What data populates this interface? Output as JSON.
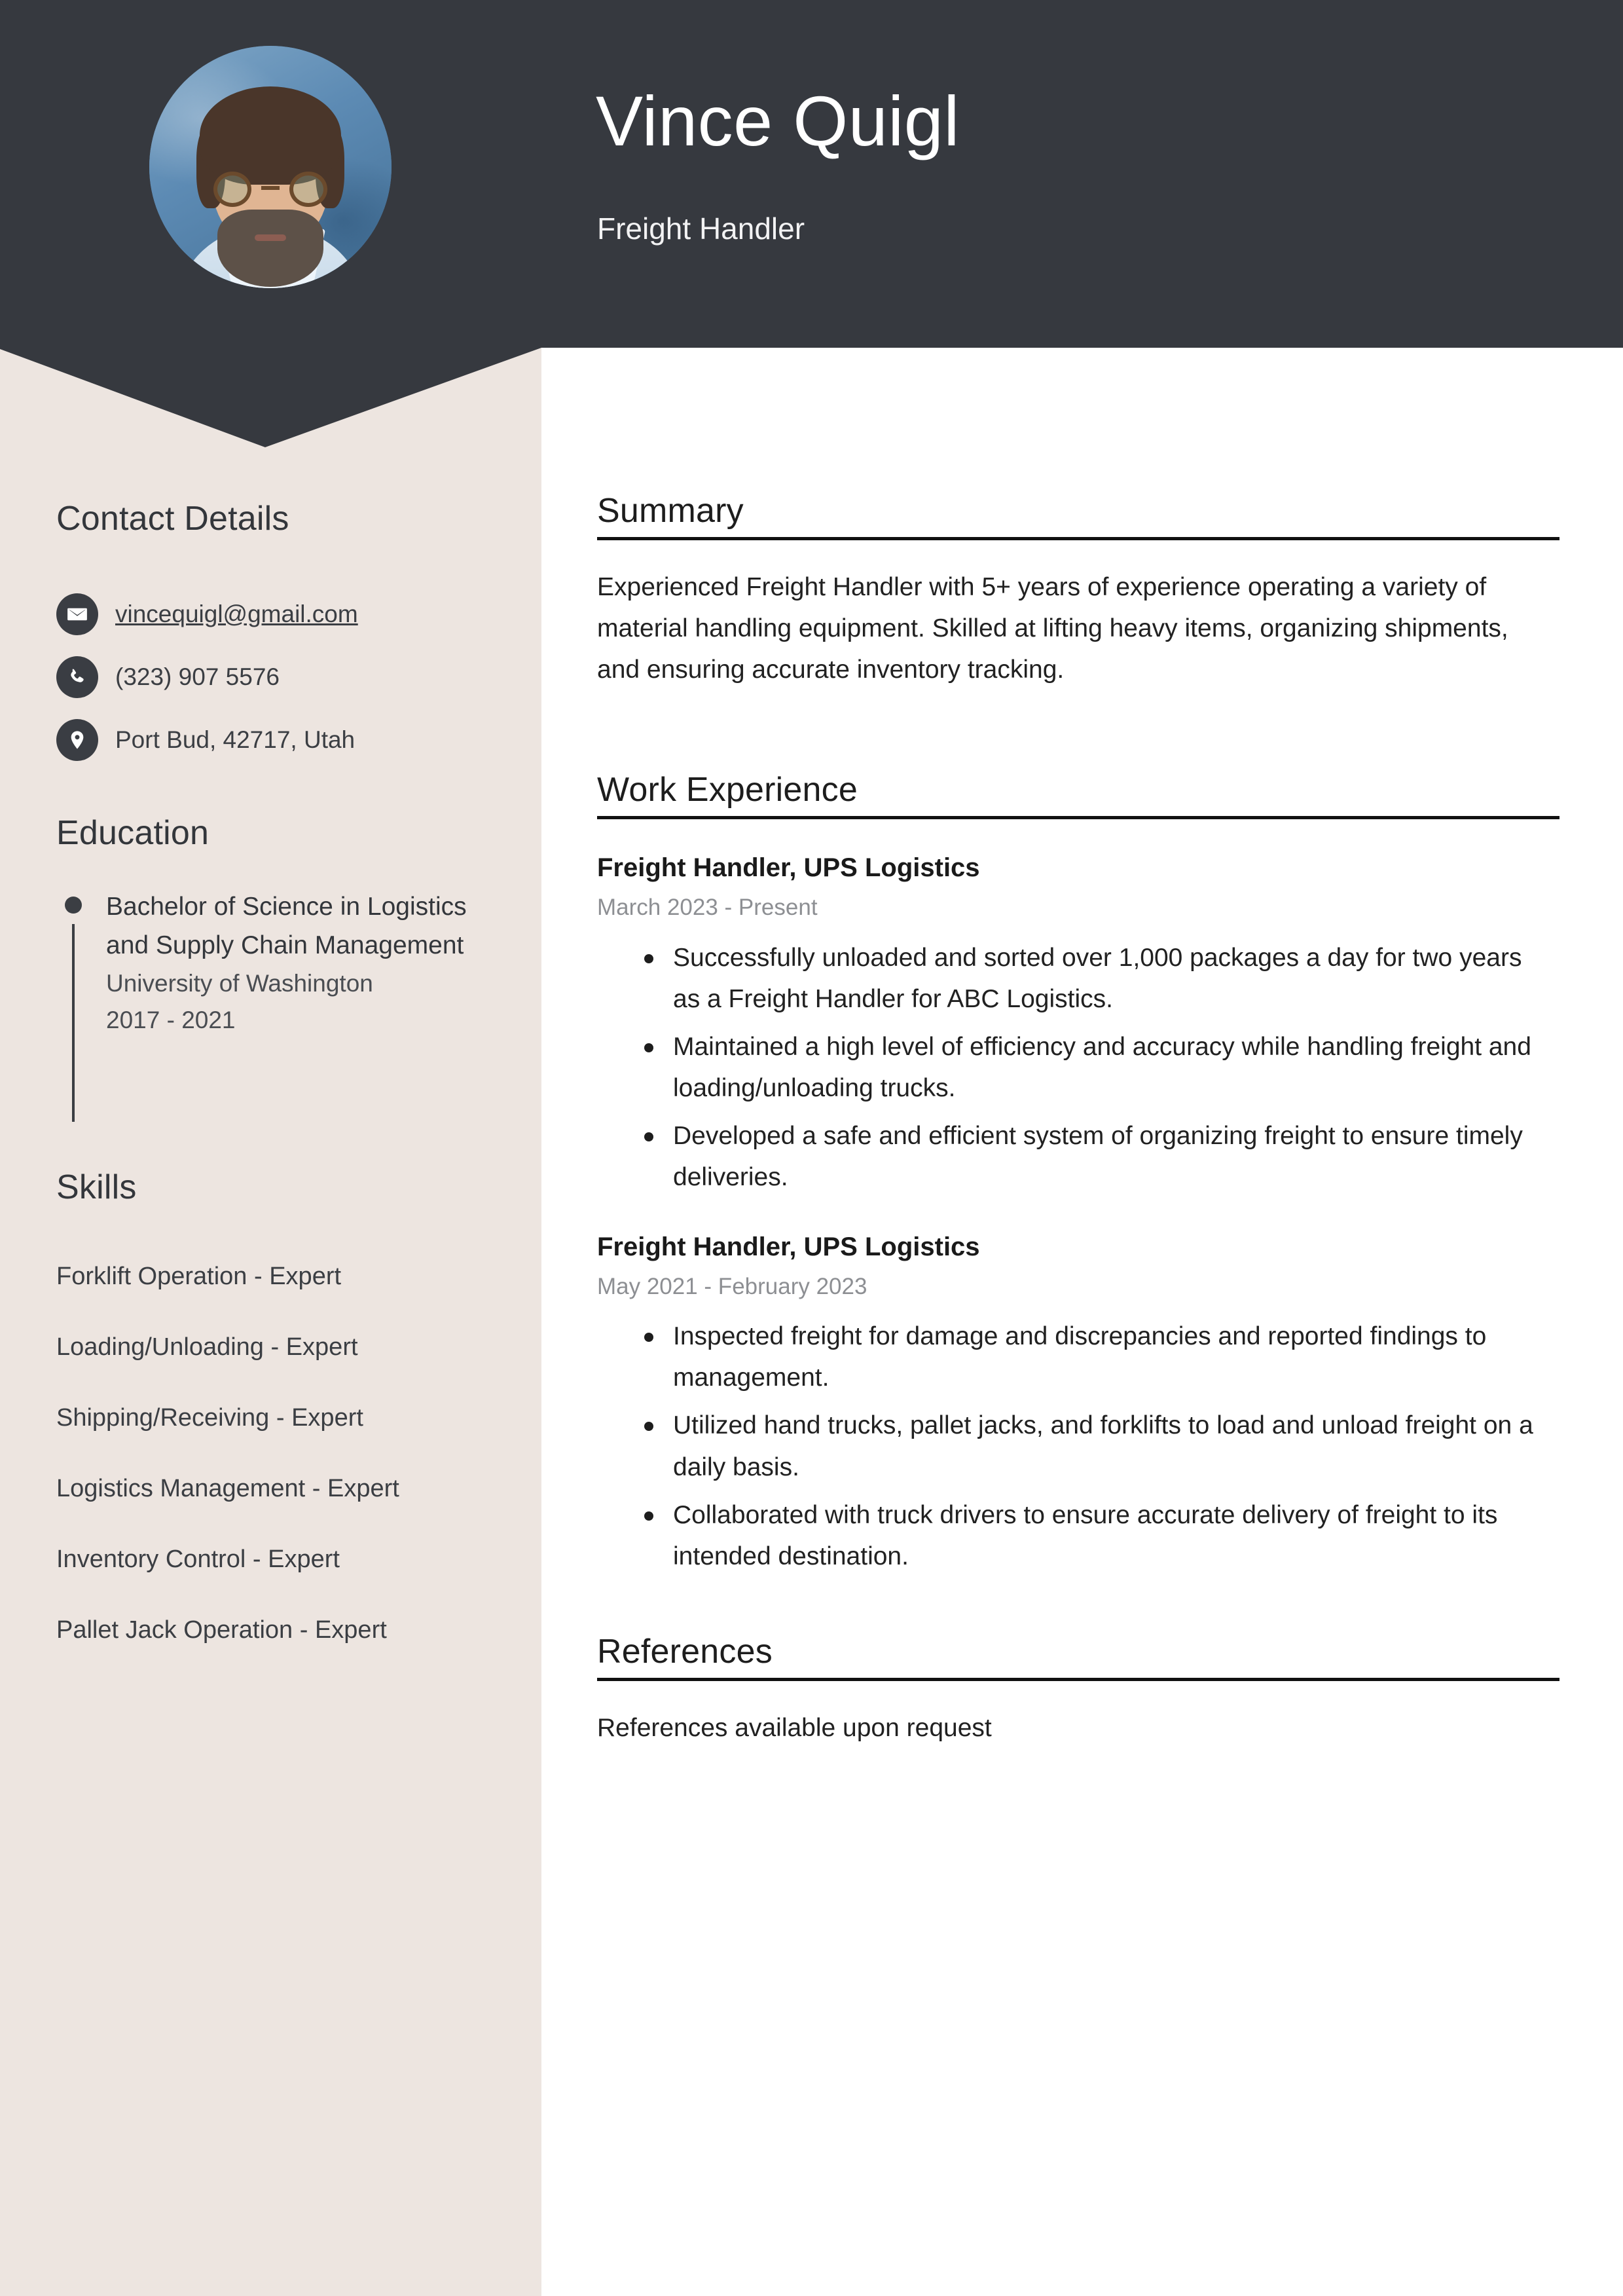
{
  "theme": {
    "header_bg": "#36393f",
    "sidebar_bg": "#ede5e0",
    "page_bg": "#ffffff",
    "heading_color": "#1d1d1d",
    "muted_text": "#8d8f93"
  },
  "header": {
    "name": "Vince Quigl",
    "job_title": "Freight Handler",
    "avatar_alt": "profile-photo"
  },
  "sidebar": {
    "contact": {
      "heading": "Contact Details",
      "items": [
        {
          "icon": "envelope-icon",
          "value": "vincequigl@gmail.com",
          "link": true
        },
        {
          "icon": "phone-icon",
          "value": "(323) 907 5576",
          "link": false
        },
        {
          "icon": "location-pin-icon",
          "value": "Port Bud, 42717, Utah",
          "link": false
        }
      ]
    },
    "education": {
      "heading": "Education",
      "entries": [
        {
          "degree": "Bachelor of Science in Logistics and Supply Chain Management",
          "school": "University of Washington",
          "years": "2017 - 2021"
        }
      ]
    },
    "skills": {
      "heading": "Skills",
      "items": [
        "Forklift Operation - Expert",
        "Loading/Unloading - Expert",
        "Shipping/Receiving - Expert",
        "Logistics Management - Expert",
        "Inventory Control - Expert",
        "Pallet Jack Operation - Expert"
      ]
    }
  },
  "main": {
    "summary": {
      "heading": "Summary",
      "text": "Experienced Freight Handler with 5+ years of experience operating a variety of material handling equipment. Skilled at lifting heavy items, organizing shipments, and ensuring accurate inventory tracking."
    },
    "work_experience": {
      "heading": "Work Experience",
      "jobs": [
        {
          "title": "Freight Handler, UPS Logistics",
          "dates": "March 2023 - Present",
          "bullets": [
            "Successfully unloaded and sorted over 1,000 packages a day for two years as a Freight Handler for ABC Logistics.",
            "Maintained a high level of efficiency and accuracy while handling freight and loading/unloading trucks.",
            "Developed a safe and efficient system of organizing freight to ensure timely deliveries."
          ]
        },
        {
          "title": "Freight Handler, UPS Logistics",
          "dates": "May 2021 - February 2023",
          "bullets": [
            "Inspected freight for damage and discrepancies and reported findings to management.",
            "Utilized hand trucks, pallet jacks, and forklifts to load and unload freight on a daily basis.",
            "Collaborated with truck drivers to ensure accurate delivery of freight to its intended destination."
          ]
        }
      ]
    },
    "references": {
      "heading": "References",
      "text": "References available upon request"
    }
  }
}
